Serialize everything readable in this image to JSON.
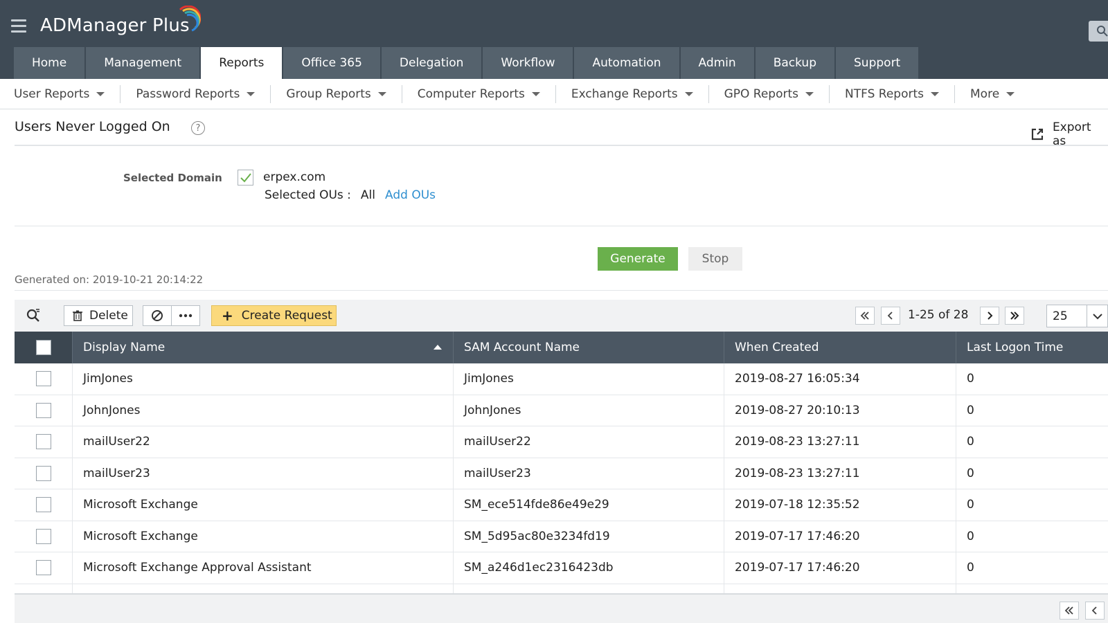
{
  "app": {
    "title": "ADManager Plus"
  },
  "main_tabs": [
    {
      "label": "Home"
    },
    {
      "label": "Management"
    },
    {
      "label": "Reports"
    },
    {
      "label": "Office 365"
    },
    {
      "label": "Delegation"
    },
    {
      "label": "Workflow"
    },
    {
      "label": "Automation"
    },
    {
      "label": "Admin"
    },
    {
      "label": "Backup"
    },
    {
      "label": "Support"
    }
  ],
  "sub_nav": [
    {
      "label": "User Reports"
    },
    {
      "label": "Password Reports"
    },
    {
      "label": "Group Reports"
    },
    {
      "label": "Computer Reports"
    },
    {
      "label": "Exchange Reports"
    },
    {
      "label": "GPO Reports"
    },
    {
      "label": "NTFS Reports"
    },
    {
      "label": "More"
    }
  ],
  "page": {
    "title": "Users Never Logged On",
    "help": "?",
    "export_label": "Export as"
  },
  "domain": {
    "label": "Selected Domain",
    "name": "erpex.com",
    "ous_label": "Selected OUs :",
    "ous_value": "All",
    "add_ous": "Add OUs"
  },
  "actions": {
    "generate": "Generate",
    "stop": "Stop"
  },
  "generated_on": "Generated on: 2019-10-21 20:14:22",
  "toolbar": {
    "delete": "Delete",
    "create_request": "Create Request",
    "pager_text": "1-25 of 28",
    "page_size": "25"
  },
  "table": {
    "columns": [
      "Display Name",
      "SAM Account Name",
      "When Created",
      "Last Logon Time"
    ],
    "rows": [
      [
        "JimJones",
        "JimJones",
        "2019-08-27 16:05:34",
        "0"
      ],
      [
        "JohnJones",
        "JohnJones",
        "2019-08-27 20:10:13",
        "0"
      ],
      [
        "mailUser22",
        "mailUser22",
        "2019-08-23 13:27:11",
        "0"
      ],
      [
        "mailUser23",
        "mailUser23",
        "2019-08-23 13:27:11",
        "0"
      ],
      [
        "Microsoft Exchange",
        "SM_ece514fde86e49e29",
        "2019-07-18 12:35:52",
        "0"
      ],
      [
        "Microsoft Exchange",
        "SM_5d95ac80e3234fd19",
        "2019-07-17 17:46:20",
        "0"
      ],
      [
        "Microsoft Exchange Approval Assistant",
        "SM_a246d1ec2316423db",
        "2019-07-17 17:46:20",
        "0"
      ]
    ]
  },
  "colors": {
    "header": "#3e4a55",
    "tab": "#55626d",
    "generate": "#6ab04c",
    "create_request": "#fbd97c",
    "link": "#2f8fd0"
  }
}
